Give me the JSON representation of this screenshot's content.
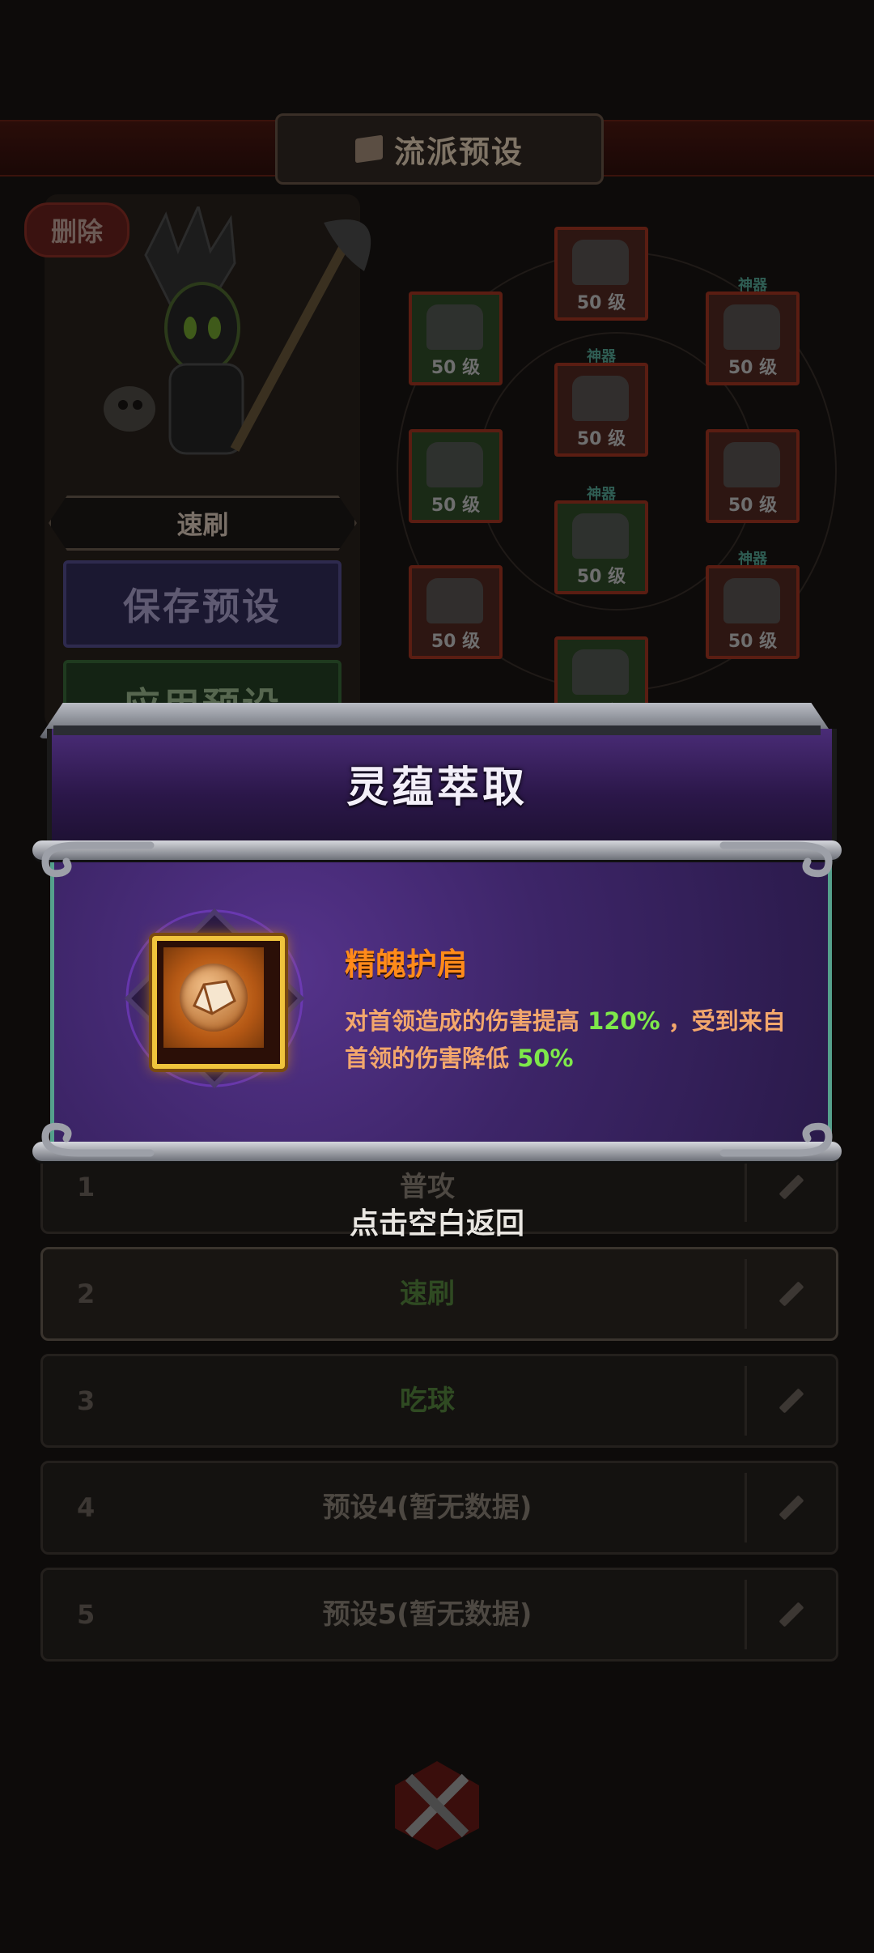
{
  "header": {
    "title": "流派预设"
  },
  "left_panel": {
    "delete_label": "删除",
    "preset_name": "速刷",
    "save_label": "保存预设",
    "apply_label": "应用预设"
  },
  "equipment": {
    "level_label": "50 级",
    "divine_tag": "神器"
  },
  "presets": [
    {
      "num": "1",
      "name": "普攻"
    },
    {
      "num": "2",
      "name": "速刷"
    },
    {
      "num": "3",
      "name": "吃球"
    },
    {
      "num": "4",
      "name": "预设4(暂无数据)"
    },
    {
      "num": "5",
      "name": "预设5(暂无数据)"
    }
  ],
  "popup": {
    "title": "灵蕴萃取",
    "item_name": "精魄护肩",
    "desc_part1": "对首领造成的伤害提高 ",
    "desc_value1": "120%",
    "desc_part2": " ，受到来自首领的伤害降低 ",
    "desc_value2": "50%",
    "tap_back": "点击空白返回"
  },
  "colors": {
    "popup_purple": "#3d2568",
    "item_name_orange": "#ff8a1a",
    "highlight_green": "#7ee84a",
    "item_border_gold": "#f0c43c"
  }
}
